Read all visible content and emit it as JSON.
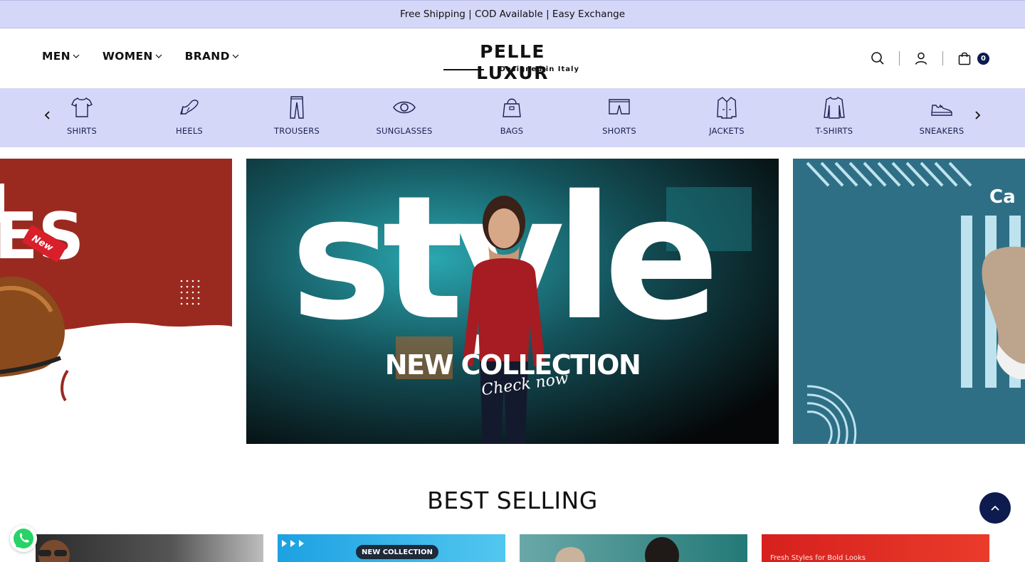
{
  "announcement": {
    "text": "Free Shipping | COD Available | Easy Exchange"
  },
  "header": {
    "nav": [
      {
        "label": "MEN"
      },
      {
        "label": "WOMEN"
      },
      {
        "label": "BRAND"
      }
    ],
    "logo": {
      "title": "PELLE LUXUR",
      "tagline": "Designed in Italy"
    },
    "cart_count": "0",
    "icons": [
      "search-icon",
      "user-icon",
      "shopping-bag-icon"
    ]
  },
  "categories": [
    {
      "label": "SHIRTS",
      "icon": "shirt-icon"
    },
    {
      "label": "HEELS",
      "icon": "heel-icon"
    },
    {
      "label": "TROUSERS",
      "icon": "trousers-icon"
    },
    {
      "label": "SUNGLASSES",
      "icon": "eye-icon"
    },
    {
      "label": "BAGS",
      "icon": "bag-icon"
    },
    {
      "label": "SHORTS",
      "icon": "shorts-icon"
    },
    {
      "label": "JACKETS",
      "icon": "jacket-icon"
    },
    {
      "label": "T-SHIRTS",
      "icon": "tshirt-icon"
    },
    {
      "label": "SNEAKERS",
      "icon": "sneaker-icon"
    }
  ],
  "banners": {
    "left": {
      "tag": "New",
      "partial_text": "ES"
    },
    "center": {
      "headline": "style",
      "title": "NEW COLLECTION",
      "script": "Check now"
    },
    "right": {
      "partial_text": "Ca"
    }
  },
  "best_selling": {
    "title": "BEST SELLING",
    "cards": [
      {
        "caption": ""
      },
      {
        "caption": "NEW COLLECTION"
      },
      {
        "caption": ""
      },
      {
        "caption": "Fresh Styles for Bold Looks"
      }
    ]
  },
  "colors": {
    "announcement_bg": "#d4d7f7",
    "accent_navy": "#0d1b4f",
    "category_text": "#1c2252"
  }
}
